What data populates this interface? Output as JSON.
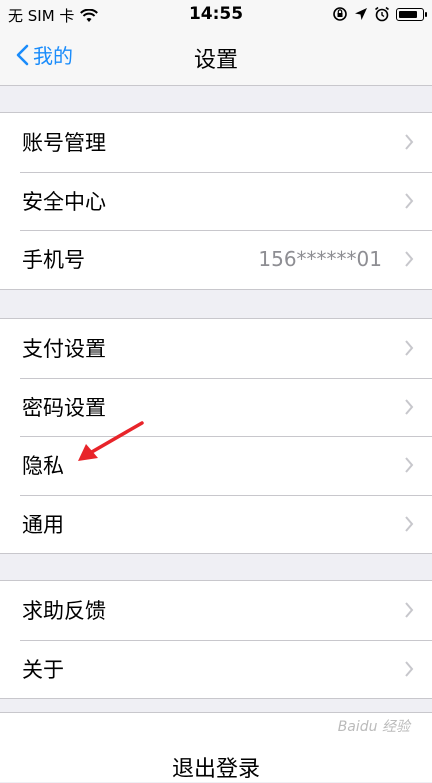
{
  "status_bar": {
    "carrier": "无 SIM 卡",
    "time": "14:55",
    "icons": [
      "wifi-icon",
      "rotation-lock-icon",
      "location-icon",
      "alarm-icon",
      "battery-icon"
    ]
  },
  "nav": {
    "back_label": "我的",
    "title": "设置"
  },
  "sections": [
    {
      "rows": [
        {
          "label": "账号管理"
        },
        {
          "label": "安全中心"
        },
        {
          "label": "手机号",
          "value": "156******01"
        }
      ]
    },
    {
      "rows": [
        {
          "label": "支付设置"
        },
        {
          "label": "密码设置"
        },
        {
          "label": "隐私"
        },
        {
          "label": "通用"
        }
      ]
    },
    {
      "rows": [
        {
          "label": "求助反馈"
        },
        {
          "label": "关于"
        }
      ]
    }
  ],
  "logout_label": "退出登录",
  "watermark": "Baidu 经验",
  "colors": {
    "accent": "#1a8cfb",
    "annotation_arrow": "#e8242a",
    "background": "#efeff4"
  }
}
